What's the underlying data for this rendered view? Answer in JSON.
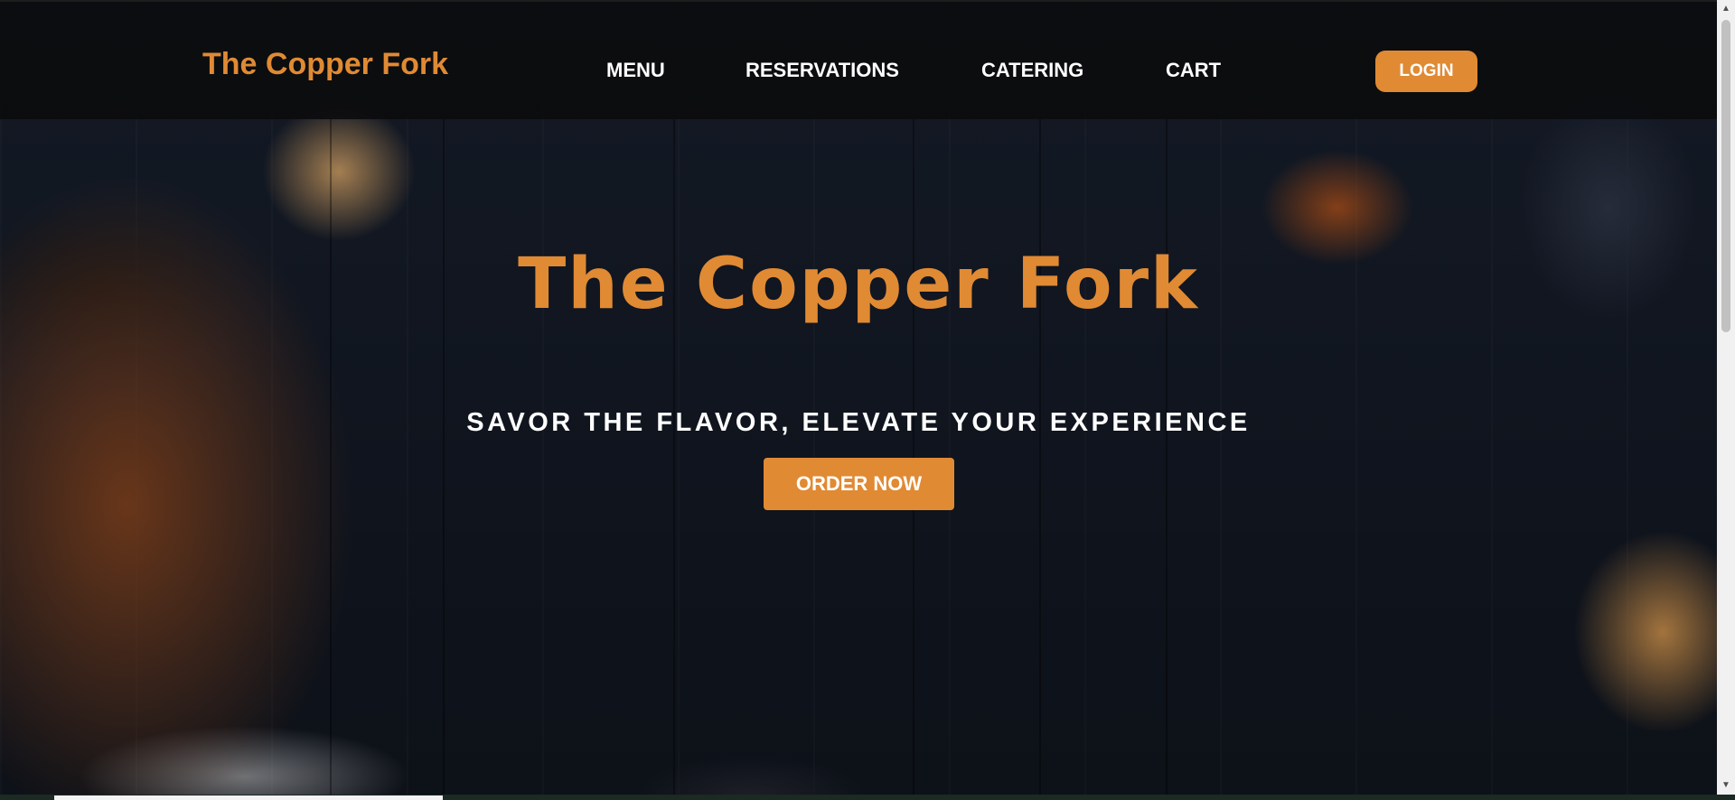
{
  "brand": {
    "name": "The Copper Fork"
  },
  "nav": {
    "items": [
      {
        "label": "MENU"
      },
      {
        "label": "RESERVATIONS"
      },
      {
        "label": "CATERING"
      },
      {
        "label": "CART"
      }
    ],
    "login_label": "LOGIN"
  },
  "hero": {
    "title": "The Copper Fork",
    "tagline": "SAVOR THE FLAVOR, ELEVATE YOUR EXPERIENCE",
    "cta_label": "ORDER NOW"
  },
  "colors": {
    "accent": "#e08a34",
    "nav_background": "#0c0c0e",
    "text": "#ffffff"
  },
  "icons": {
    "scroll_up": "triangle-up",
    "scroll_down": "triangle-down"
  }
}
